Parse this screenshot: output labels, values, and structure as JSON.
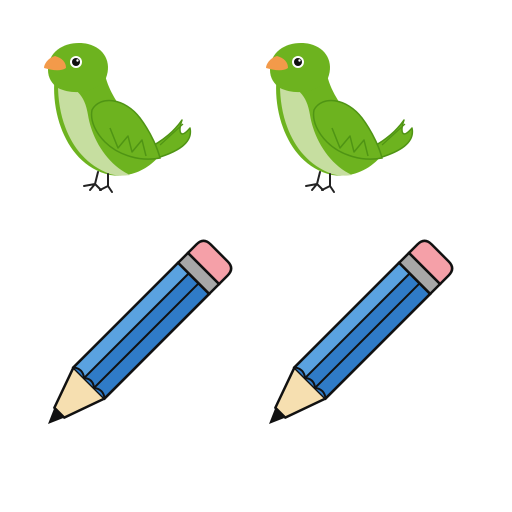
{
  "page": {
    "background": "#ffffff"
  },
  "items": {
    "birds": {
      "count": 2,
      "kind": "bird",
      "colors": {
        "body": "#6db31f",
        "body_dark": "#4f9414",
        "belly": "#c6dea0",
        "beak": "#f39a4a",
        "eye": "#111111",
        "eye_ring": "#ffffff",
        "feet": "#222222"
      }
    },
    "pencils": {
      "count": 2,
      "kind": "pencil",
      "colors": {
        "body": "#2f7bc7",
        "body_light": "#5aa2e0",
        "eraser": "#f5a0a8",
        "ferrule": "#a7a7a7",
        "wood": "#f6dfb0",
        "lead": "#111111",
        "outline": "#111111"
      }
    }
  }
}
